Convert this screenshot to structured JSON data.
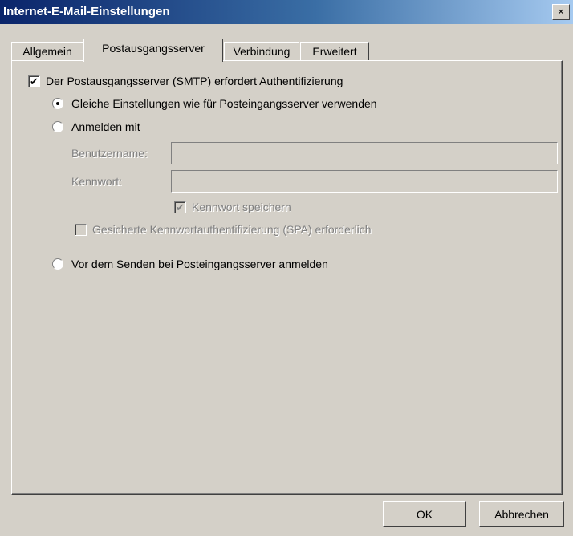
{
  "window": {
    "title": "Internet-E-Mail-Einstellungen",
    "close_glyph": "×"
  },
  "tabs": [
    {
      "label": "Allgemein"
    },
    {
      "label": "Postausgangsserver",
      "active": true
    },
    {
      "label": "Verbindung"
    },
    {
      "label": "Erweitert"
    }
  ],
  "outgoing": {
    "auth_required_label": "Der Postausgangsserver (SMTP) erfordert Authentifizierung",
    "auth_required_checked": true,
    "same_settings_label": "Gleiche Einstellungen wie für Posteingangsserver verwenden",
    "same_settings_selected": true,
    "login_with_label": "Anmelden mit",
    "username_label": "Benutzername:",
    "username_value": "",
    "password_label": "Kennwort:",
    "password_value": "",
    "remember_password_label": "Kennwort speichern",
    "remember_password_checked": true,
    "spa_label": "Gesicherte Kennwortauthentifizierung (SPA) erforderlich",
    "spa_checked": false,
    "login_before_send_label": "Vor dem Senden bei Posteingangsserver anmelden"
  },
  "buttons": {
    "ok_label": "OK",
    "cancel_label": "Abbrechen"
  },
  "colors": {
    "dialog_bg": "#d4d0c8",
    "titlebar_start": "#0a246a",
    "titlebar_end": "#a6caf0",
    "disabled_text": "#808080"
  }
}
